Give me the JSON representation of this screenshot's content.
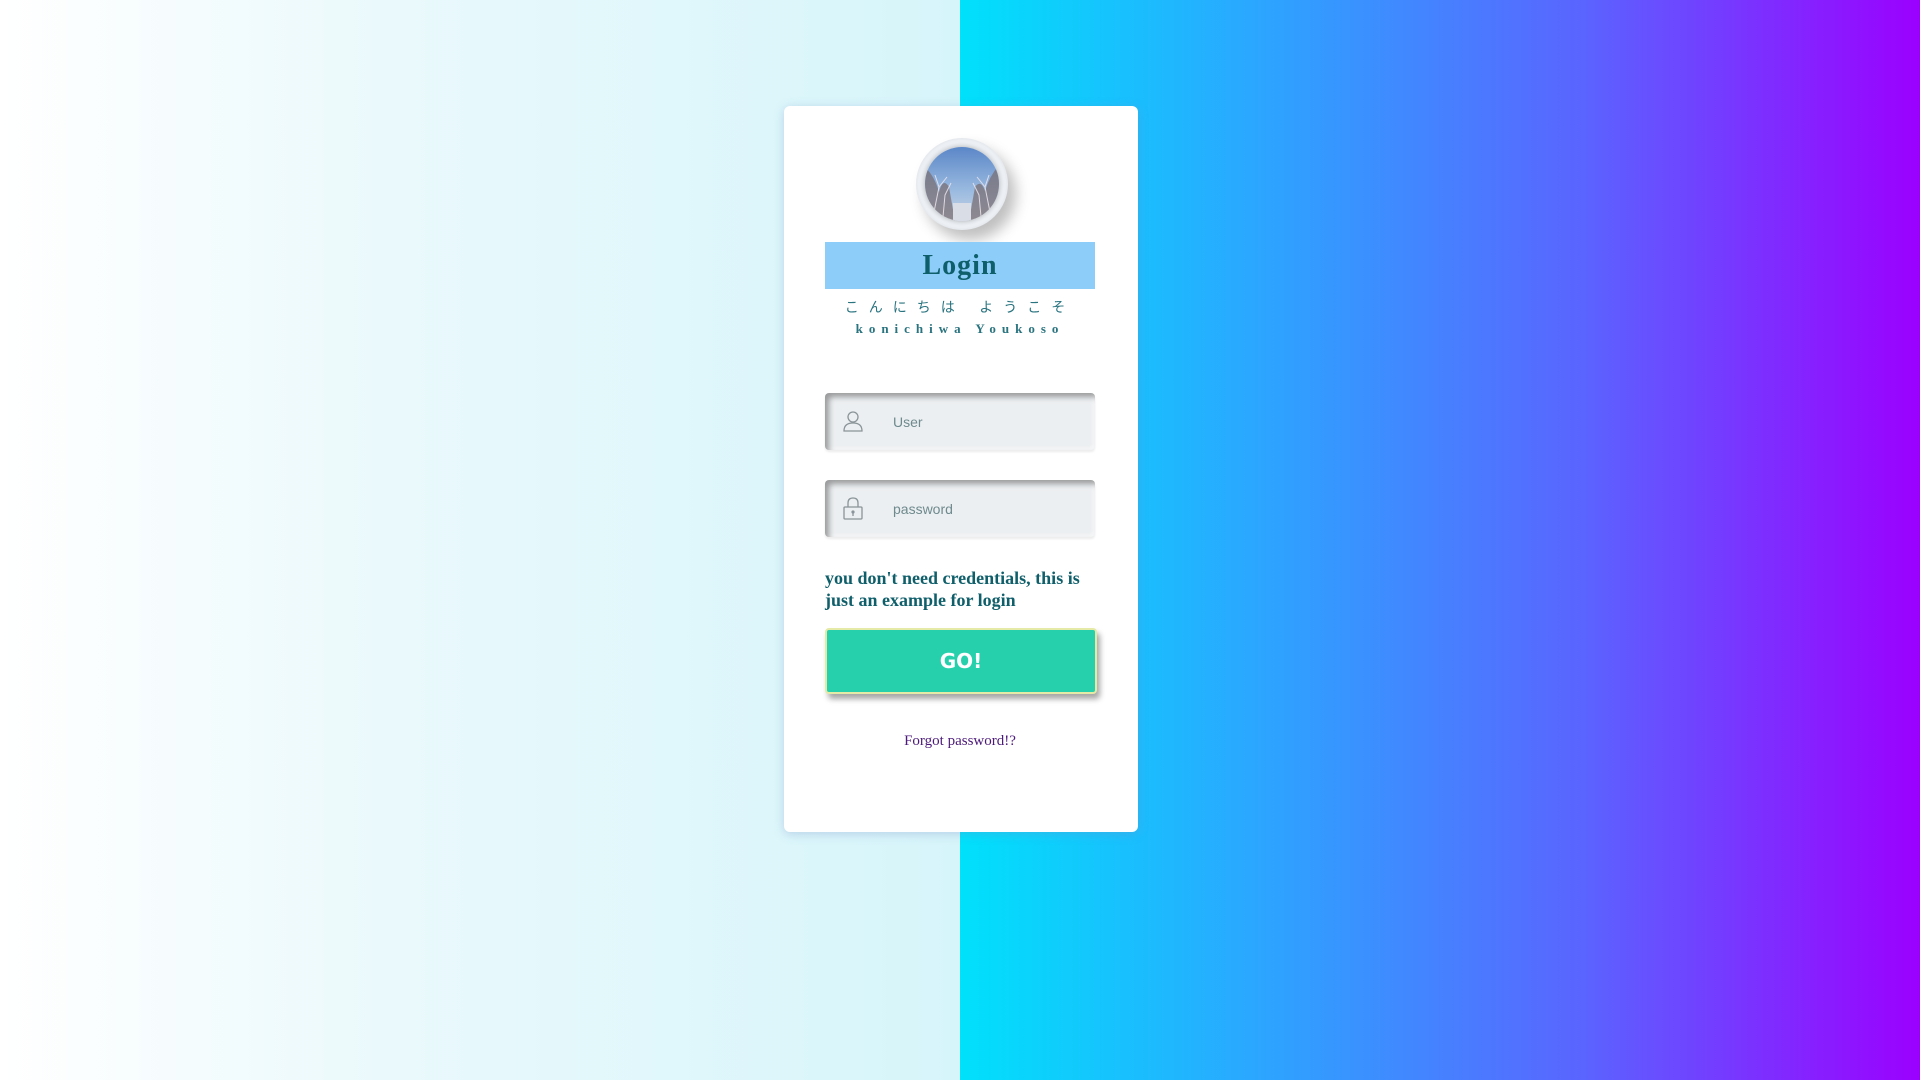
{
  "login": {
    "title": "Login",
    "subtitle_jp": "こんにちは ようこそ",
    "subtitle_romaji": "konichiwa Youkoso",
    "user_placeholder": "User",
    "password_placeholder": "password",
    "note": "you don't need credentials, this is just an example for login",
    "go_label": "GO!",
    "forgot_label": "Forgot password!?"
  },
  "icons": {
    "avatar": "avatar-tree-photo",
    "user": "user-icon",
    "password": "lock-icon"
  },
  "colors": {
    "title_bar": "#8dcdfa",
    "title_text": "#0f5f6b",
    "go_button": "#26d0ac",
    "forgot_link": "#4c1a7a"
  }
}
